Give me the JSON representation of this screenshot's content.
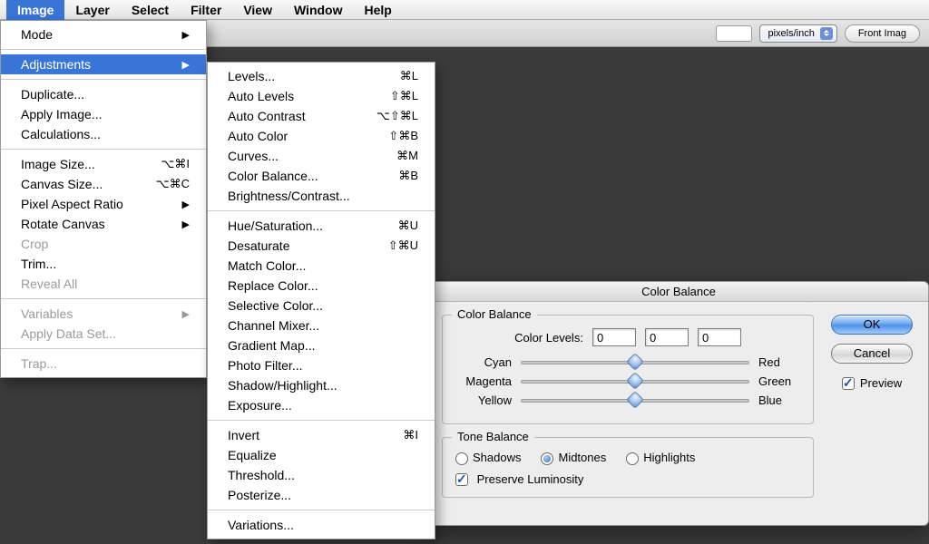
{
  "menubar": [
    "Image",
    "Layer",
    "Select",
    "Filter",
    "View",
    "Window",
    "Help"
  ],
  "activeMenu": "Image",
  "toolbar": {
    "units": "pixels/inch",
    "frontBtn": "Front Imag"
  },
  "imageMenu": {
    "groups": [
      [
        {
          "label": "Mode",
          "arrow": true
        }
      ],
      [
        {
          "label": "Adjustments",
          "arrow": true,
          "highlight": true
        }
      ],
      [
        {
          "label": "Duplicate..."
        },
        {
          "label": "Apply Image..."
        },
        {
          "label": "Calculations..."
        }
      ],
      [
        {
          "label": "Image Size...",
          "short": "⌥⌘I"
        },
        {
          "label": "Canvas Size...",
          "short": "⌥⌘C"
        },
        {
          "label": "Pixel Aspect Ratio",
          "arrow": true
        },
        {
          "label": "Rotate Canvas",
          "arrow": true
        },
        {
          "label": "Crop",
          "disabled": true
        },
        {
          "label": "Trim..."
        },
        {
          "label": "Reveal All",
          "disabled": true
        }
      ],
      [
        {
          "label": "Variables",
          "arrow": true,
          "disabled": true
        },
        {
          "label": "Apply Data Set...",
          "disabled": true
        }
      ],
      [
        {
          "label": "Trap...",
          "disabled": true
        }
      ]
    ]
  },
  "adjustMenu": {
    "groups": [
      [
        {
          "label": "Levels...",
          "short": "⌘L"
        },
        {
          "label": "Auto Levels",
          "short": "⇧⌘L"
        },
        {
          "label": "Auto Contrast",
          "short": "⌥⇧⌘L"
        },
        {
          "label": "Auto Color",
          "short": "⇧⌘B"
        },
        {
          "label": "Curves...",
          "short": "⌘M"
        },
        {
          "label": "Color Balance...",
          "short": "⌘B"
        },
        {
          "label": "Brightness/Contrast..."
        }
      ],
      [
        {
          "label": "Hue/Saturation...",
          "short": "⌘U"
        },
        {
          "label": "Desaturate",
          "short": "⇧⌘U"
        },
        {
          "label": "Match Color..."
        },
        {
          "label": "Replace Color..."
        },
        {
          "label": "Selective Color..."
        },
        {
          "label": "Channel Mixer..."
        },
        {
          "label": "Gradient Map..."
        },
        {
          "label": "Photo Filter..."
        },
        {
          "label": "Shadow/Highlight..."
        },
        {
          "label": "Exposure..."
        }
      ],
      [
        {
          "label": "Invert",
          "short": "⌘I"
        },
        {
          "label": "Equalize"
        },
        {
          "label": "Threshold..."
        },
        {
          "label": "Posterize..."
        }
      ],
      [
        {
          "label": "Variations..."
        }
      ]
    ]
  },
  "dialog": {
    "title": "Color Balance",
    "section1": "Color Balance",
    "levelsLabel": "Color Levels:",
    "levels": [
      "0",
      "0",
      "0"
    ],
    "sliders": [
      {
        "left": "Cyan",
        "right": "Red"
      },
      {
        "left": "Magenta",
        "right": "Green"
      },
      {
        "left": "Yellow",
        "right": "Blue"
      }
    ],
    "section2": "Tone Balance",
    "tones": [
      {
        "label": "Shadows",
        "checked": false
      },
      {
        "label": "Midtones",
        "checked": true
      },
      {
        "label": "Highlights",
        "checked": false
      }
    ],
    "preserve": {
      "label": "Preserve Luminosity",
      "checked": true
    },
    "ok": "OK",
    "cancel": "Cancel",
    "preview": {
      "label": "Preview",
      "checked": true
    }
  }
}
